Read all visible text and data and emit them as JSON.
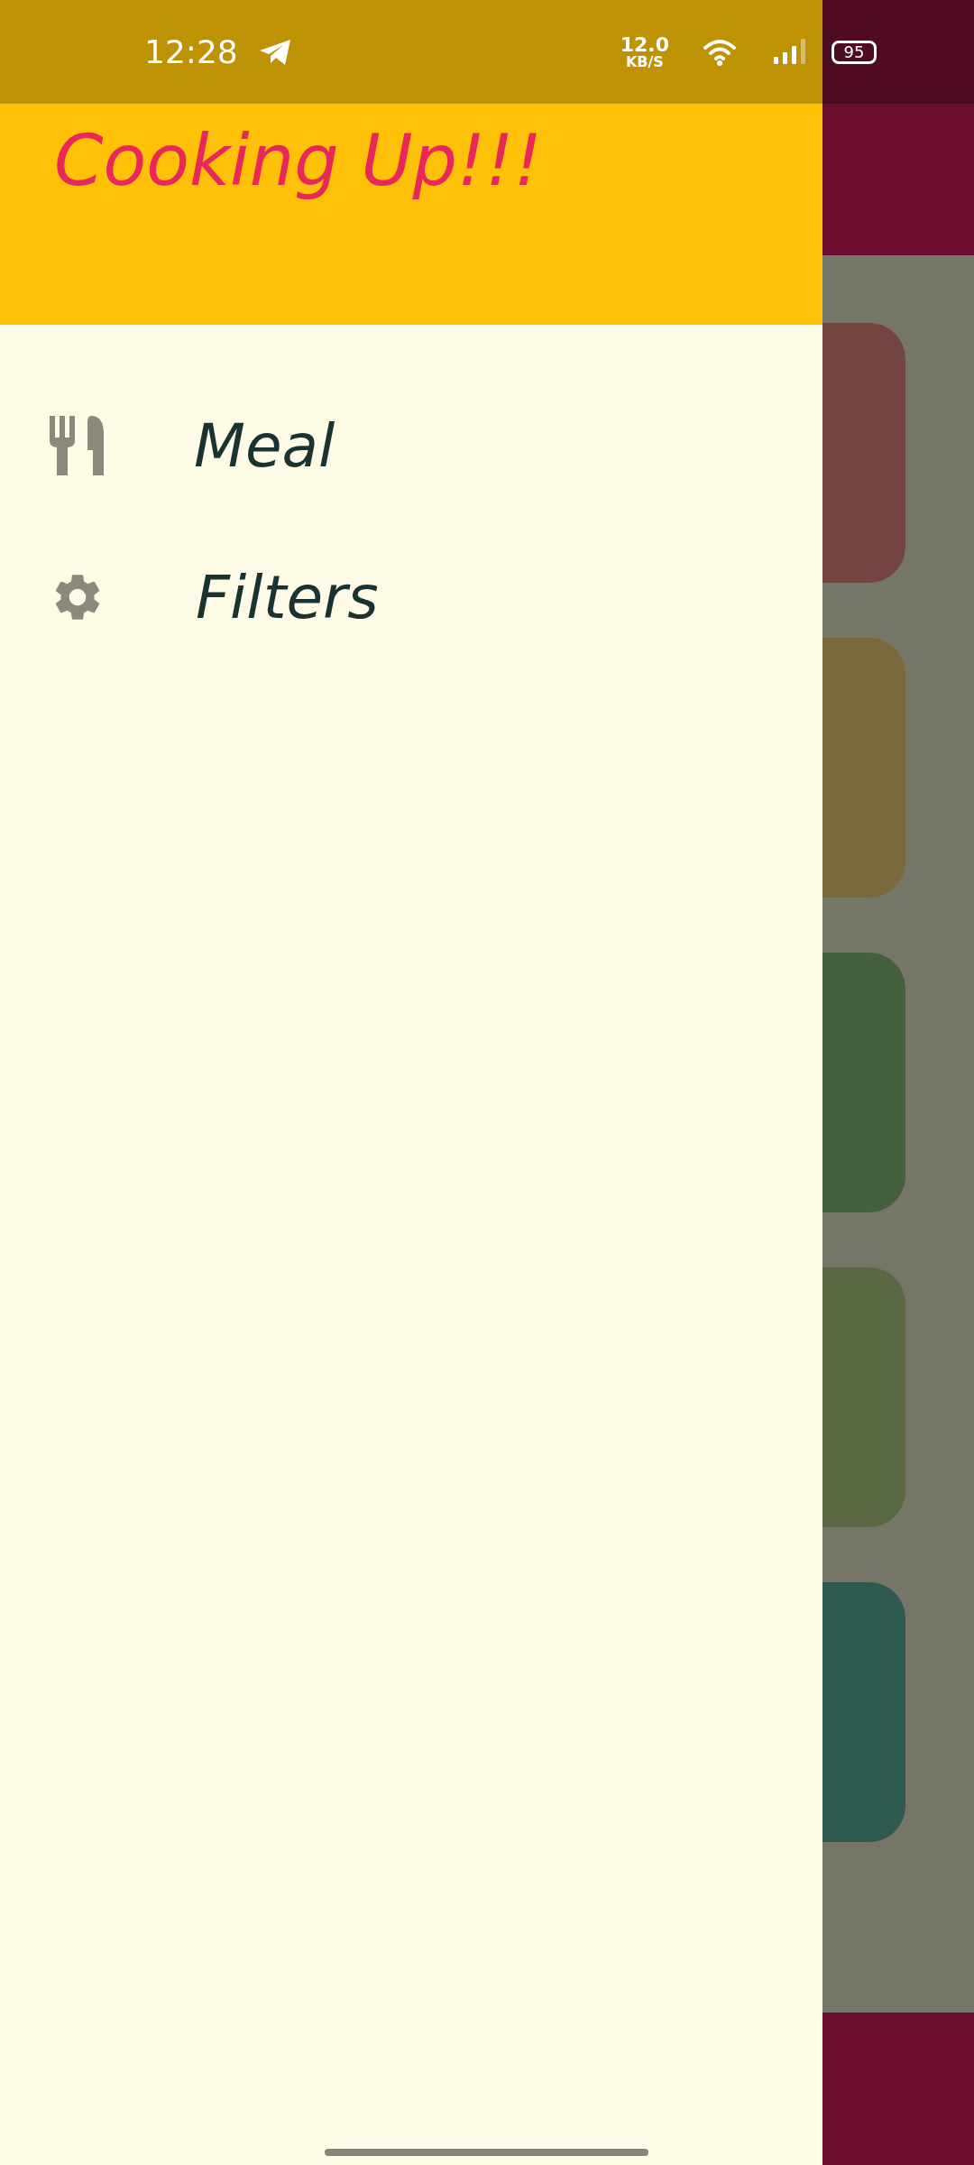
{
  "status_bar": {
    "time": "12:28",
    "net_speed": "12.0",
    "net_speed_unit": "KB/S",
    "battery": "95"
  },
  "drawer": {
    "title": "Cooking Up!!!",
    "items": [
      {
        "label": "Meal",
        "kind": "cutlery"
      },
      {
        "label": "Filters",
        "kind": "gear"
      }
    ]
  },
  "background_cards": [
    {
      "color": "#744540"
    },
    {
      "color": "#786a3c"
    },
    {
      "color": "#44603f"
    },
    {
      "color": "#5a6843"
    },
    {
      "color": "#2f5a50"
    }
  ]
}
